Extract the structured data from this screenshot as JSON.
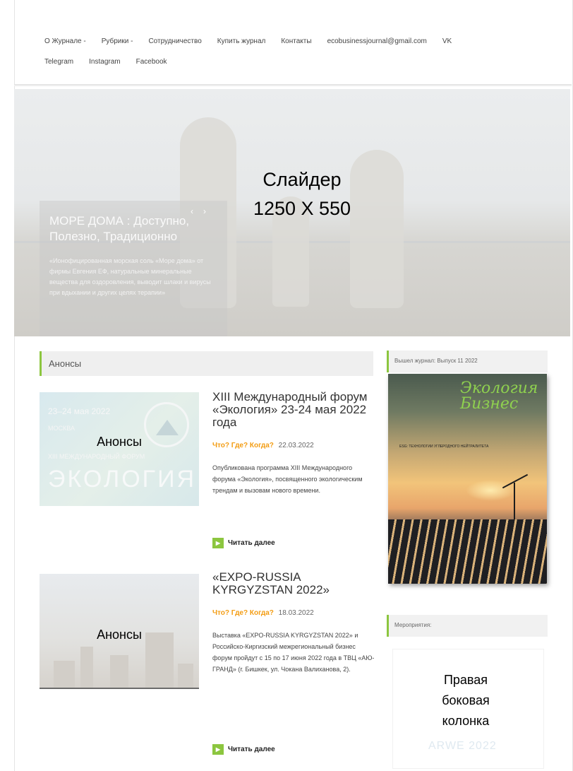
{
  "nav": {
    "row1": [
      "О Журнале -",
      "Рубрики -",
      "Сотрудничество",
      "Купить журнал",
      "Контакты",
      "ecobusinessjournal@gmail.com",
      "VK"
    ],
    "row2": [
      "Telegram",
      "Instagram",
      "Facebook"
    ]
  },
  "slider": {
    "label_line1": "Слайдер",
    "label_line2": "1250 X 550",
    "caption_title": "МОРЕ ДОМА : Доступно, Полезно, Традиционно",
    "caption_text": "«Ионофицированная морская соль «Море дома» от фирмы Евгения ЕФ, натуральные минеральные вещества для оздоровления, выводит шлаки и вирусы при вдыхании и других целях терапии»",
    "prev": "‹",
    "next": "›"
  },
  "announcements": {
    "heading": "Анонсы",
    "posts": [
      {
        "thumb_label": "Анонсы",
        "thumb_date": "23–24 мая 2022",
        "thumb_city": "МОСКВА",
        "thumb_sub": "XIII МЕЖДУНАРОДНЫЙ ФОРУМ",
        "thumb_big": "ЭКОЛОГИЯ",
        "title": "XIII Международный форум «Экология» 23-24 мая 2022 года",
        "meta_link": "Что? Где? Когда?",
        "date": "22.03.2022",
        "excerpt": "Опубликована программа XIII Международного форума «Экология», посвященного экологическим трендам и вызовам нового времени.",
        "read_more": "Читать далее"
      },
      {
        "thumb_label": "Анонсы",
        "title": "«EXPO-RUSSIA KYRGYZSTAN 2022»",
        "meta_link": "Что? Где? Когда?",
        "date": "18.03.2022",
        "excerpt": "Выставка «EXPO-RUSSIA KYRGYZSTAN 2022» и Российско-Киргизский межрегиональный бизнес форум пройдут с 15 по 17 июня 2022 года в ТВЦ «АЮ-ГРАНД» (г. Бишкек, ул. Чокана Валиханова, 2).",
        "read_more": "Читать далее"
      }
    ]
  },
  "sidebar": {
    "widget1_title": "Вышел журнал: Выпуск 11 2022",
    "magazine": {
      "title_line1": "Экология",
      "title_line2": "Бизнес",
      "heading": "ESG: ТЕХНОЛОГИИ УГЛЕРОДНОГО НЕЙТРАЛИТЕТА"
    },
    "widget2_title": "Мероприятия:",
    "box_label_line1": "Правая",
    "box_label_line2": "боковая",
    "box_label_line3": "колонка",
    "box_faded_text": "ARWE 2022"
  },
  "colors": {
    "accent_green": "#8cc63f",
    "meta_orange": "#f39c12"
  }
}
